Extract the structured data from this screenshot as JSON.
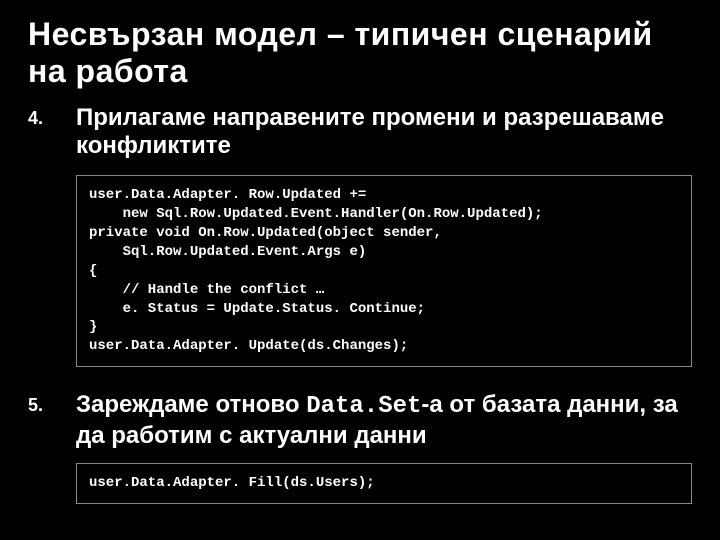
{
  "title": "Несвързан модел – типичен сценарий на работа",
  "items": [
    {
      "num": "4.",
      "heading_pre": "Прилагаме направените промени и разрешаваме конфликтите",
      "heading_mono": "",
      "heading_post": "",
      "code": "user.Data.Adapter. Row.Updated +=\n    new Sql.Row.Updated.Event.Handler(On.Row.Updated);\nprivate void On.Row.Updated(object sender,\n    Sql.Row.Updated.Event.Args e)\n{\n    // Handle the conflict …\n    e. Status = Update.Status. Continue;\n}\nuser.Data.Adapter. Update(ds.Changes);"
    },
    {
      "num": "5.",
      "heading_pre": "Зареждаме отново ",
      "heading_mono": "Data.Set",
      "heading_post": "-а от базата данни, за да работим с актуални данни",
      "code": "user.Data.Adapter. Fill(ds.Users);"
    }
  ]
}
